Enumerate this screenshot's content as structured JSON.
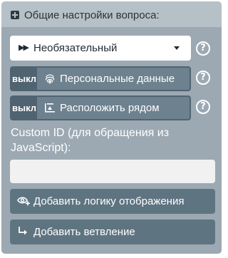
{
  "panel": {
    "title": "Общие настройки вопроса:",
    "header_icon": "plus-square-icon"
  },
  "requirement_select": {
    "lead_icon": "double-chevron-right-icon",
    "lead_glyph": "▶▶",
    "value": "Необязательный",
    "help": "?"
  },
  "toggles": [
    {
      "state_label": "выкл",
      "label": "Персональные данные",
      "icon": "fingerprint-icon",
      "help": "?"
    },
    {
      "state_label": "выкл",
      "label": "Расположить рядом",
      "icon": "align-side-icon",
      "help": "?"
    }
  ],
  "custom_id": {
    "label": "Custom ID (для обращения из JavaScript):",
    "value": ""
  },
  "actions": [
    {
      "label": "Добавить логику отображения",
      "icon": "eye-plus-icon"
    },
    {
      "label": "Добавить ветвление",
      "icon": "branch-arrow-icon"
    }
  ],
  "colors": {
    "panel_bg": "#9ca9b3",
    "header_bg": "#b6c0c7",
    "toggle_bg": "#6e818f",
    "toggle_off_bg": "#4f6371",
    "action_bg": "#5f7481"
  }
}
